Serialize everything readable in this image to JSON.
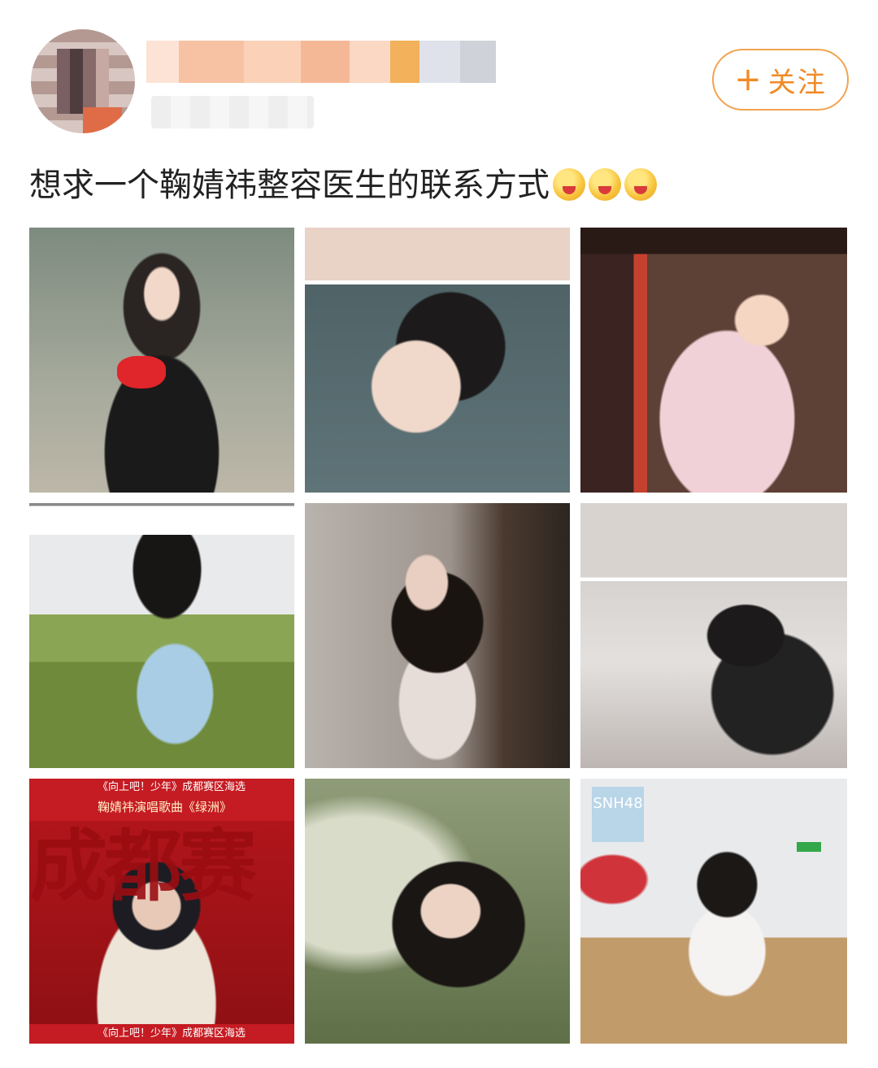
{
  "post": {
    "follow_button": {
      "icon": "plus-icon",
      "label": "关注",
      "plus": "+"
    },
    "text": "想求一个鞠婧祎整容医生的联系方式",
    "emojis": [
      "yum-face-emoji",
      "yum-face-emoji",
      "yum-face-emoji"
    ]
  },
  "grid": {
    "tile7": {
      "top_caption": "《向上吧！少年》成都赛区海选",
      "sub_caption": "鞠婧祎演唱歌曲《绿洲》",
      "big_text": "成都赛",
      "bottom_caption": "《向上吧！少年》成都赛区海选"
    },
    "tile9": {
      "logo_label": "SNH48"
    }
  },
  "colors": {
    "accent": "#f08a26",
    "follow_border": "#f3a34f",
    "text": "#222222"
  }
}
